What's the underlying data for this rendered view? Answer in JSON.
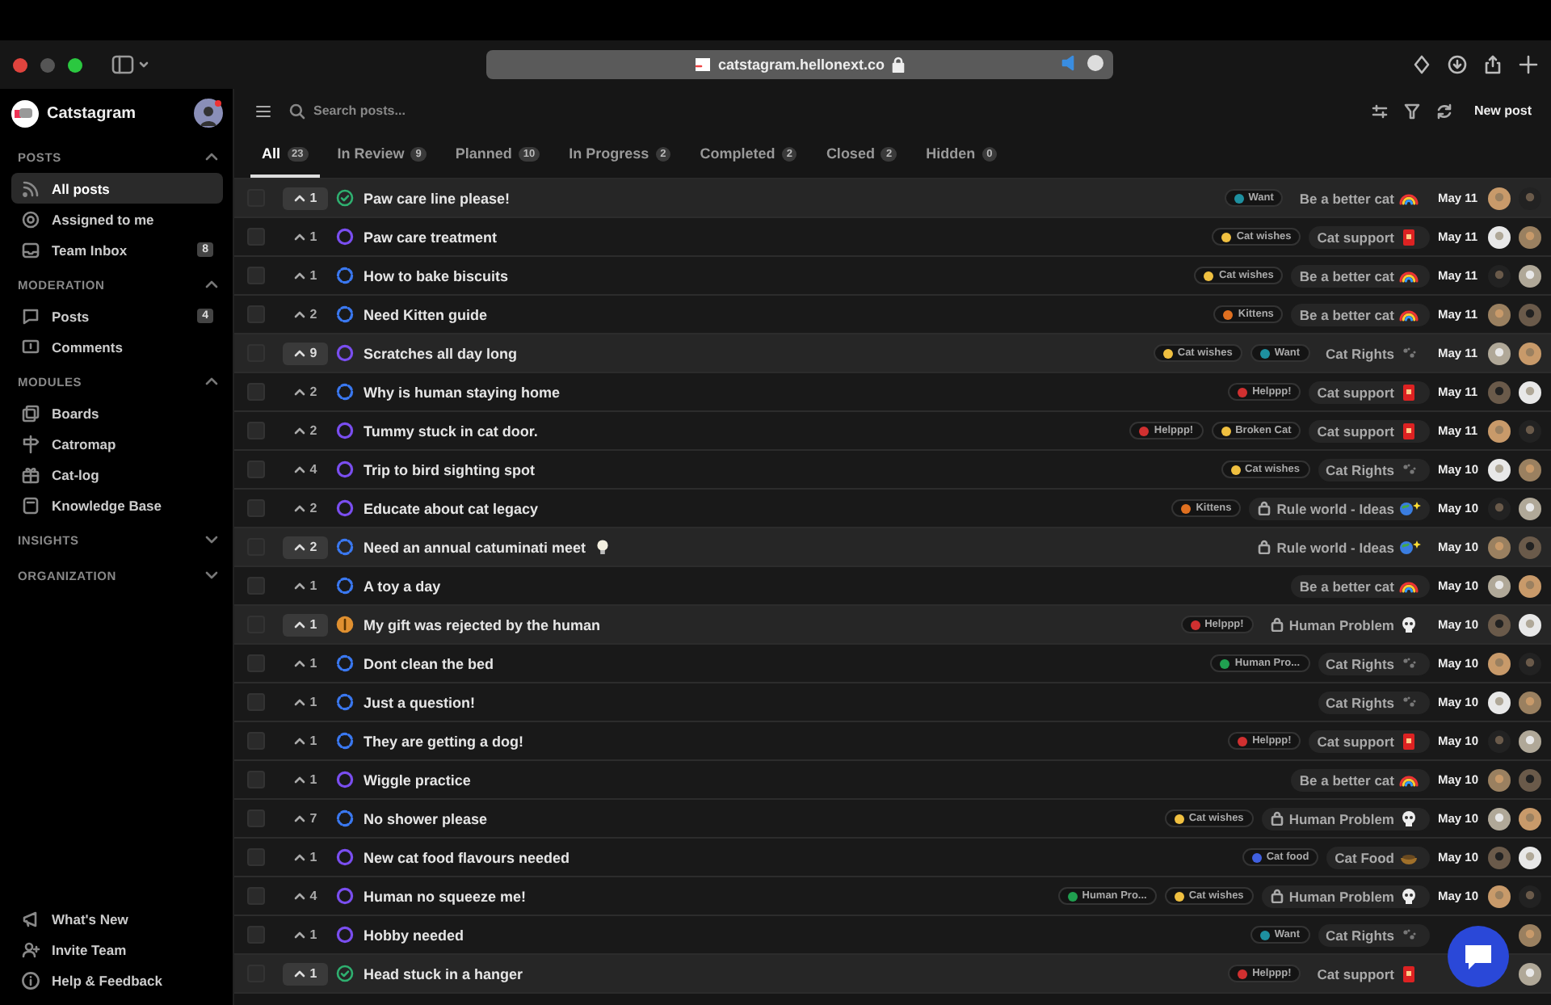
{
  "browser": {
    "url": "catstagram.hellonext.co"
  },
  "sidebar": {
    "brand": "Catstagram",
    "sections": [
      {
        "title": "POSTS",
        "expanded": true,
        "items": [
          {
            "label": "All posts",
            "kind": "rss",
            "selected": true
          },
          {
            "label": "Assigned to me",
            "kind": "at",
            "selected": false
          },
          {
            "label": "Team Inbox",
            "kind": "inbox",
            "badge": "8",
            "selected": false
          }
        ]
      },
      {
        "title": "MODERATION",
        "expanded": true,
        "items": [
          {
            "label": "Posts",
            "kind": "chat",
            "badge": "4",
            "selected": false
          },
          {
            "label": "Comments",
            "kind": "comment",
            "selected": false
          }
        ]
      },
      {
        "title": "MODULES",
        "expanded": true,
        "items": [
          {
            "label": "Boards",
            "kind": "boards",
            "selected": false
          },
          {
            "label": "Catromap",
            "kind": "signpost",
            "selected": false
          },
          {
            "label": "Cat-log",
            "kind": "gift",
            "selected": false
          },
          {
            "label": "Knowledge Base",
            "kind": "book",
            "selected": false
          }
        ]
      },
      {
        "title": "INSIGHTS",
        "expanded": false
      },
      {
        "title": "ORGANIZATION",
        "expanded": false
      }
    ],
    "footer": [
      {
        "label": "What's New",
        "kind": "megaphone"
      },
      {
        "label": "Invite Team",
        "kind": "user-plus"
      },
      {
        "label": "Help & Feedback",
        "kind": "info"
      }
    ]
  },
  "toolbar": {
    "search": {
      "placeholder": "Search posts..."
    },
    "new_post": "New post"
  },
  "tabs": [
    {
      "label": "All",
      "count": "23",
      "selected": true
    },
    {
      "label": "In Review",
      "count": "9",
      "selected": false
    },
    {
      "label": "Planned",
      "count": "10",
      "selected": false
    },
    {
      "label": "In Progress",
      "count": "2",
      "selected": false
    },
    {
      "label": "Completed",
      "count": "2",
      "selected": false
    },
    {
      "label": "Closed",
      "count": "2",
      "selected": false
    },
    {
      "label": "Hidden",
      "count": "0",
      "selected": false
    }
  ],
  "posts": [
    {
      "votes": "1",
      "kind": "completed",
      "title": "Paw care line please!",
      "highlighted": true,
      "checked": false,
      "tags": [
        {
          "label": "Want",
          "color": "#1e90a0"
        }
      ],
      "category": {
        "label": "Be a better cat",
        "kind": "rainbow",
        "locked": false
      },
      "date": "May 11"
    },
    {
      "votes": "1",
      "kind": "planned",
      "title": "Paw care treatment",
      "highlighted": false,
      "checked": false,
      "tags": [
        {
          "label": "Cat wishes",
          "color": "#f0c040"
        }
      ],
      "category": {
        "label": "Cat support",
        "kind": "envelope",
        "locked": false
      },
      "date": "May 11"
    },
    {
      "votes": "1",
      "kind": "review",
      "title": "How to bake biscuits",
      "highlighted": false,
      "checked": false,
      "tags": [
        {
          "label": "Cat wishes",
          "color": "#f0c040"
        }
      ],
      "category": {
        "label": "Be a better cat",
        "kind": "rainbow",
        "locked": false
      },
      "date": "May 11"
    },
    {
      "votes": "2",
      "kind": "review",
      "title": "Need Kitten guide",
      "highlighted": false,
      "checked": false,
      "tags": [
        {
          "label": "Kittens",
          "color": "#e07020"
        }
      ],
      "category": {
        "label": "Be a better cat",
        "kind": "rainbow",
        "locked": false
      },
      "date": "May 11"
    },
    {
      "votes": "9",
      "kind": "planned",
      "title": "Scratches all day long",
      "highlighted": true,
      "checked": false,
      "tags": [
        {
          "label": "Cat wishes",
          "color": "#f0c040"
        },
        {
          "label": "Want",
          "color": "#1e90a0"
        }
      ],
      "category": {
        "label": "Cat Rights",
        "kind": "paws",
        "locked": false
      },
      "date": "May 11"
    },
    {
      "votes": "2",
      "kind": "review",
      "title": "Why is human staying home",
      "highlighted": false,
      "checked": false,
      "tags": [
        {
          "label": "Helppp!",
          "color": "#d03030"
        }
      ],
      "category": {
        "label": "Cat support",
        "kind": "envelope",
        "locked": false
      },
      "date": "May 11"
    },
    {
      "votes": "2",
      "kind": "planned",
      "title": "Tummy stuck in cat door.",
      "highlighted": false,
      "checked": false,
      "tags": [
        {
          "label": "Helppp!",
          "color": "#d03030"
        },
        {
          "label": "Broken Cat",
          "color": "#f0c040"
        }
      ],
      "category": {
        "label": "Cat support",
        "kind": "envelope",
        "locked": false
      },
      "date": "May 11"
    },
    {
      "votes": "4",
      "kind": "planned",
      "title": "Trip to bird sighting spot",
      "highlighted": false,
      "checked": false,
      "tags": [
        {
          "label": "Cat wishes",
          "color": "#f0c040"
        }
      ],
      "category": {
        "label": "Cat Rights",
        "kind": "paws",
        "locked": false
      },
      "date": "May 10"
    },
    {
      "votes": "2",
      "kind": "planned",
      "title": "Educate about cat legacy",
      "highlighted": false,
      "checked": false,
      "tags": [
        {
          "label": "Kittens",
          "color": "#e07020"
        }
      ],
      "category": {
        "label": "Rule world - Ideas",
        "kind": "globe",
        "locked": true
      },
      "date": "May 10"
    },
    {
      "votes": "2",
      "kind": "review",
      "title": "Need an annual catuminati meet",
      "title_emoji": {
        "kind": "bulb"
      },
      "highlighted": true,
      "checked": false,
      "category": {
        "label": "Rule world - Ideas",
        "kind": "globe",
        "locked": true
      },
      "date": "May 10"
    },
    {
      "votes": "1",
      "kind": "review",
      "title": "A toy a day",
      "highlighted": false,
      "checked": false,
      "category": {
        "label": "Be a better cat",
        "kind": "rainbow",
        "locked": false
      },
      "date": "May 10"
    },
    {
      "votes": "1",
      "kind": "progress",
      "title": "My gift was rejected by the human",
      "highlighted": true,
      "checked": false,
      "tags": [
        {
          "label": "Helppp!",
          "color": "#d03030"
        }
      ],
      "category": {
        "label": "Human Problem",
        "kind": "skull",
        "locked": true
      },
      "date": "May 10"
    },
    {
      "votes": "1",
      "kind": "review",
      "title": "Dont clean the bed",
      "highlighted": false,
      "checked": false,
      "tags": [
        {
          "label": "Human Pro...",
          "color": "#20a050"
        }
      ],
      "category": {
        "label": "Cat Rights",
        "kind": "paws",
        "locked": false
      },
      "date": "May 10"
    },
    {
      "votes": "1",
      "kind": "review",
      "title": "Just a question!",
      "highlighted": false,
      "checked": false,
      "category": {
        "label": "Cat Rights",
        "kind": "paws",
        "locked": false
      },
      "date": "May 10"
    },
    {
      "votes": "1",
      "kind": "review",
      "title": "They are getting a dog!",
      "highlighted": false,
      "checked": false,
      "tags": [
        {
          "label": "Helppp!",
          "color": "#d03030"
        }
      ],
      "category": {
        "label": "Cat support",
        "kind": "envelope",
        "locked": false
      },
      "date": "May 10"
    },
    {
      "votes": "1",
      "kind": "planned",
      "title": "Wiggle practice",
      "highlighted": false,
      "checked": false,
      "category": {
        "label": "Be a better cat",
        "kind": "rainbow",
        "locked": false
      },
      "date": "May 10"
    },
    {
      "votes": "7",
      "kind": "review",
      "title": "No shower please",
      "highlighted": false,
      "checked": false,
      "tags": [
        {
          "label": "Cat wishes",
          "color": "#f0c040"
        }
      ],
      "category": {
        "label": "Human Problem",
        "kind": "skull",
        "locked": true
      },
      "date": "May 10"
    },
    {
      "votes": "1",
      "kind": "planned",
      "title": "New cat food flavours needed",
      "highlighted": false,
      "checked": false,
      "tags": [
        {
          "label": "Cat food",
          "color": "#4060e0"
        }
      ],
      "category": {
        "label": "Cat Food",
        "kind": "bowl",
        "locked": false
      },
      "date": "May 10"
    },
    {
      "votes": "4",
      "kind": "planned",
      "title": "Human no squeeze me!",
      "highlighted": false,
      "checked": false,
      "tags": [
        {
          "label": "Human Pro...",
          "color": "#20a050"
        },
        {
          "label": "Cat wishes",
          "color": "#f0c040"
        }
      ],
      "category": {
        "label": "Human Problem",
        "kind": "skull",
        "locked": true
      },
      "date": "May 10"
    },
    {
      "votes": "1",
      "kind": "planned",
      "title": "Hobby needed",
      "highlighted": false,
      "checked": false,
      "tags": [
        {
          "label": "Want",
          "color": "#1e90a0"
        }
      ],
      "category": {
        "label": "Cat Rights",
        "kind": "paws",
        "locked": false
      }
    },
    {
      "votes": "1",
      "kind": "completed",
      "title": "Head stuck in a hanger",
      "highlighted": true,
      "checked": false,
      "tags": [
        {
          "label": "Helppp!",
          "color": "#d03030"
        }
      ],
      "category": {
        "label": "Cat support",
        "kind": "envelope",
        "locked": false
      }
    }
  ]
}
